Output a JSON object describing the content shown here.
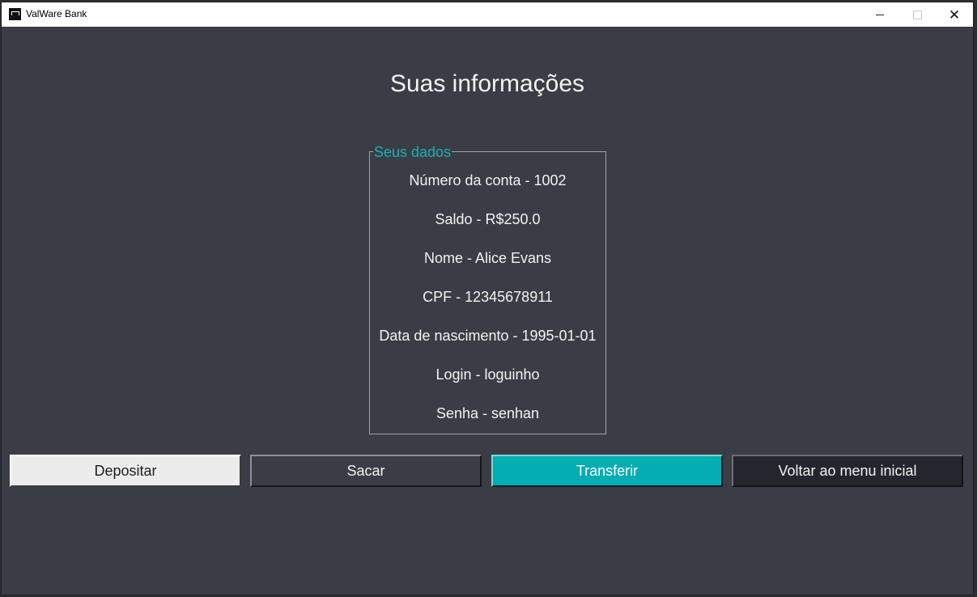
{
  "window": {
    "title": "ValWare Bank",
    "controls": {
      "minimize": "minimize-icon",
      "maximize": "maximize-icon",
      "close": "close-icon"
    }
  },
  "page": {
    "heading": "Suas informações"
  },
  "account_box": {
    "legend": "Seus dados",
    "lines": [
      "Número da conta - 1002",
      "Saldo - R$250.0",
      "Nome - Alice Evans",
      "CPF - 12345678911",
      "Data de nascimento - 1995-01-01",
      "Login - loguinho",
      "Senha - senhan"
    ]
  },
  "actions": {
    "deposit": "Depositar",
    "withdraw": "Sacar",
    "transfer": "Transferir",
    "back": "Voltar ao menu inicial"
  },
  "colors": {
    "background": "#3a3d45",
    "accent": "#03adb2",
    "legend": "#17b2b6"
  }
}
